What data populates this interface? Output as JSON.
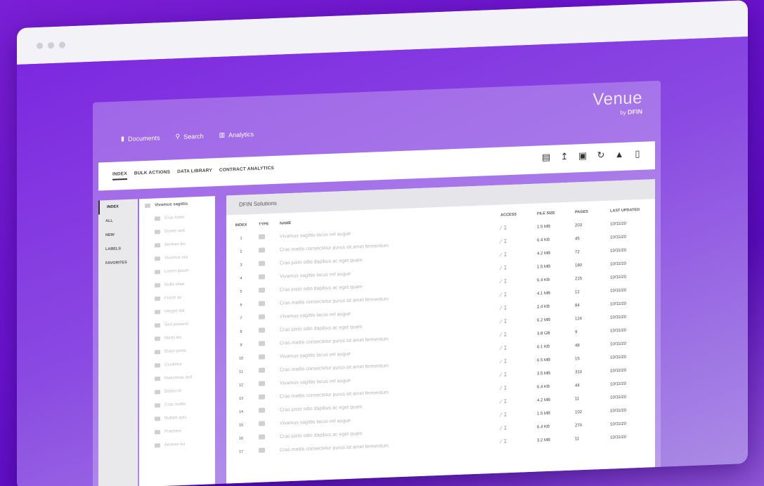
{
  "app": {
    "brand": "Venue",
    "brand_by": "by",
    "brand_company": "DFIN",
    "top_nav": [
      {
        "label": "Documents",
        "icon": "document-icon"
      },
      {
        "label": "Search",
        "icon": "search-icon"
      },
      {
        "label": "Analytics",
        "icon": "bar-chart-icon"
      }
    ],
    "sub_tabs": [
      "INDEX",
      "BULK ACTIONS",
      "DATA LIBRARY",
      "CONTRACT ANALYTICS"
    ],
    "toolbar_icons": [
      "clipboard-icon",
      "upload-icon",
      "folder-upload-icon",
      "refresh-icon",
      "alert-icon",
      "document-new-icon"
    ],
    "left_nav": [
      "INDEX",
      "ALL",
      "NEW",
      "LABELS",
      "FAVORITES"
    ],
    "tree": {
      "root": "Vivamus sagittis",
      "items": [
        "Cras tortor",
        "Donec sed",
        "Aenean leo",
        "Vivamus nisi",
        "Lorem ipsum",
        "Nulla vitae",
        "Fusce ac",
        "Integer dui",
        "Sed posuere",
        "Morbi leo",
        "Etiam porta",
        "Curabitur",
        "Maecenas sed",
        "Donec id",
        "Cras mattis",
        "Nullam quis",
        "Praesent",
        "Aenean eu"
      ]
    },
    "folder_title": "DFIN Solutions",
    "columns": {
      "index": "INDEX",
      "type": "TYPE",
      "name": "NAME",
      "access": "ACCESS",
      "size": "FILE SIZE",
      "pages": "PAGES",
      "updated": "LAST UPDATED"
    },
    "rows": [
      {
        "index": "1",
        "name": "Vivamus sagittis lacus vel augue",
        "size": "1.5 MB",
        "pages": "203",
        "updated": "10/11/20"
      },
      {
        "index": "2",
        "name": "Cras mattis consectetur purus sit amet fermentum",
        "size": "6.4 KB",
        "pages": "45",
        "updated": "10/11/20"
      },
      {
        "index": "3",
        "name": "Cras justo odio dapibus ac eget quam",
        "size": "4.2 MB",
        "pages": "72",
        "updated": "10/11/20"
      },
      {
        "index": "4",
        "name": "Vivamus sagittis lacus vel augue",
        "size": "1.5 MB",
        "pages": "180",
        "updated": "10/11/20"
      },
      {
        "index": "5",
        "name": "Cras justo odio dapibus ac eget quam",
        "size": "6.4 KB",
        "pages": "215",
        "updated": "10/11/20"
      },
      {
        "index": "6",
        "name": "Cras mattis consectetur purus sit amet fermentum",
        "size": "4.1 MB",
        "pages": "12",
        "updated": "10/11/20"
      },
      {
        "index": "7",
        "name": "Vivamus sagittis lacus vel augue",
        "size": "2.4 KB",
        "pages": "84",
        "updated": "10/11/20"
      },
      {
        "index": "8",
        "name": "Cras justo odio dapibus ac eget quam",
        "size": "6.2 MB",
        "pages": "124",
        "updated": "10/11/20"
      },
      {
        "index": "9",
        "name": "Cras mattis consectetur purus sit amet fermentum",
        "size": "3.8 GB",
        "pages": "9",
        "updated": "10/11/20"
      },
      {
        "index": "10",
        "name": "Vivamus sagittis lacus vel augue",
        "size": "6.1 KB",
        "pages": "48",
        "updated": "10/11/20"
      },
      {
        "index": "11",
        "name": "Cras mattis consectetur purus sit amet fermentum",
        "size": "6.5 MB",
        "pages": "15",
        "updated": "10/11/20"
      },
      {
        "index": "12",
        "name": "Vivamus sagittis lacus vel augue",
        "size": "3.5 MB",
        "pages": "310",
        "updated": "10/11/20"
      },
      {
        "index": "13",
        "name": "Cras mattis consectetur purus sit amet fermentum",
        "size": "6.4 KB",
        "pages": "44",
        "updated": "10/11/20"
      },
      {
        "index": "14",
        "name": "Cras justo odio dapibus ac eget quam",
        "size": "4.2 MB",
        "pages": "11",
        "updated": "10/11/20"
      },
      {
        "index": "15",
        "name": "Vivamus sagittis lacus vel augue",
        "size": "1.5 MB",
        "pages": "102",
        "updated": "10/11/20"
      },
      {
        "index": "16",
        "name": "Cras justo odio dapibus ac eget quam",
        "size": "6.4 KB",
        "pages": "270",
        "updated": "10/11/20"
      },
      {
        "index": "17",
        "name": "Cras mattis consectetur purus sit amet fermentum",
        "size": "3.2 MB",
        "pages": "11",
        "updated": "10/11/20"
      }
    ]
  }
}
